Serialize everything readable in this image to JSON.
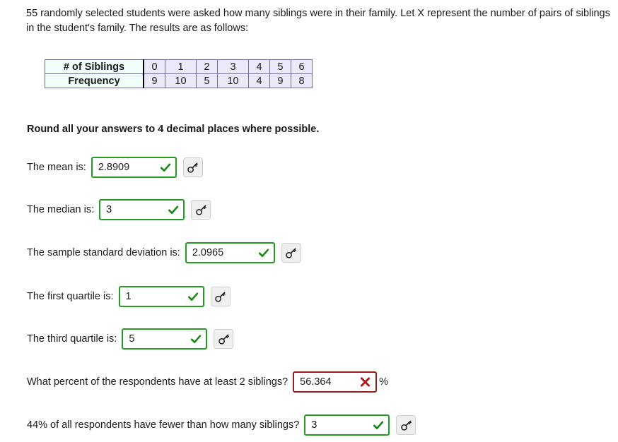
{
  "prompt": {
    "text": "55 randomly selected students were asked how many siblings were in their family. Let X represent the number of pairs of siblings in the student's family. The results are as follows:"
  },
  "table": {
    "row_labels": [
      "# of Siblings",
      "Frequency"
    ],
    "siblings": [
      "0",
      "1",
      "2",
      "3",
      "4",
      "5",
      "6"
    ],
    "frequency": [
      "9",
      "10",
      "5",
      "10",
      "4",
      "9",
      "8"
    ]
  },
  "instruction": "Round all your answers to 4 decimal places where possible.",
  "questions": [
    {
      "label": "The mean is:",
      "value": "2.8909",
      "status": "correct",
      "status_icon": "green-check-icon",
      "has_key_button": true,
      "suffix": "",
      "input_width": 121
    },
    {
      "label": "The median is:",
      "value": "3",
      "status": "correct",
      "status_icon": "green-check-icon",
      "has_key_button": true,
      "suffix": "",
      "input_width": 121
    },
    {
      "label": "The sample standard deviation is:",
      "value": "2.0965",
      "status": "correct",
      "status_icon": "green-check-icon",
      "has_key_button": true,
      "suffix": "",
      "input_width": 127
    },
    {
      "label": "The first quartile is:",
      "value": "1",
      "status": "correct",
      "status_icon": "green-check-icon",
      "has_key_button": true,
      "suffix": "",
      "input_width": 121
    },
    {
      "label": "The third quartile is:",
      "value": "5",
      "status": "correct",
      "status_icon": "green-check-icon",
      "has_key_button": true,
      "suffix": "",
      "input_width": 121
    },
    {
      "label": "What percent of the respondents have at least 2 siblings?",
      "value": "56.364",
      "status": "incorrect",
      "status_icon": "red-x-icon",
      "has_key_button": false,
      "suffix": "%",
      "input_width": 119
    },
    {
      "label": "44% of all respondents have fewer than how many siblings?",
      "value": "3",
      "status": "correct",
      "status_icon": "green-check-icon",
      "has_key_button": true,
      "suffix": "",
      "input_width": 121
    }
  ],
  "key_button": {
    "icon": "key-icon",
    "title": "Solution key"
  },
  "colors": {
    "correct_border": "#1f9d1f",
    "incorrect_border": "#9a1c1c",
    "check_mark": "#128a12",
    "x_mark": "#b01616",
    "table_header_bg": "#effdfb",
    "table_cell_bg": "#e9e9fa",
    "table_border": "#6b6b9e"
  }
}
